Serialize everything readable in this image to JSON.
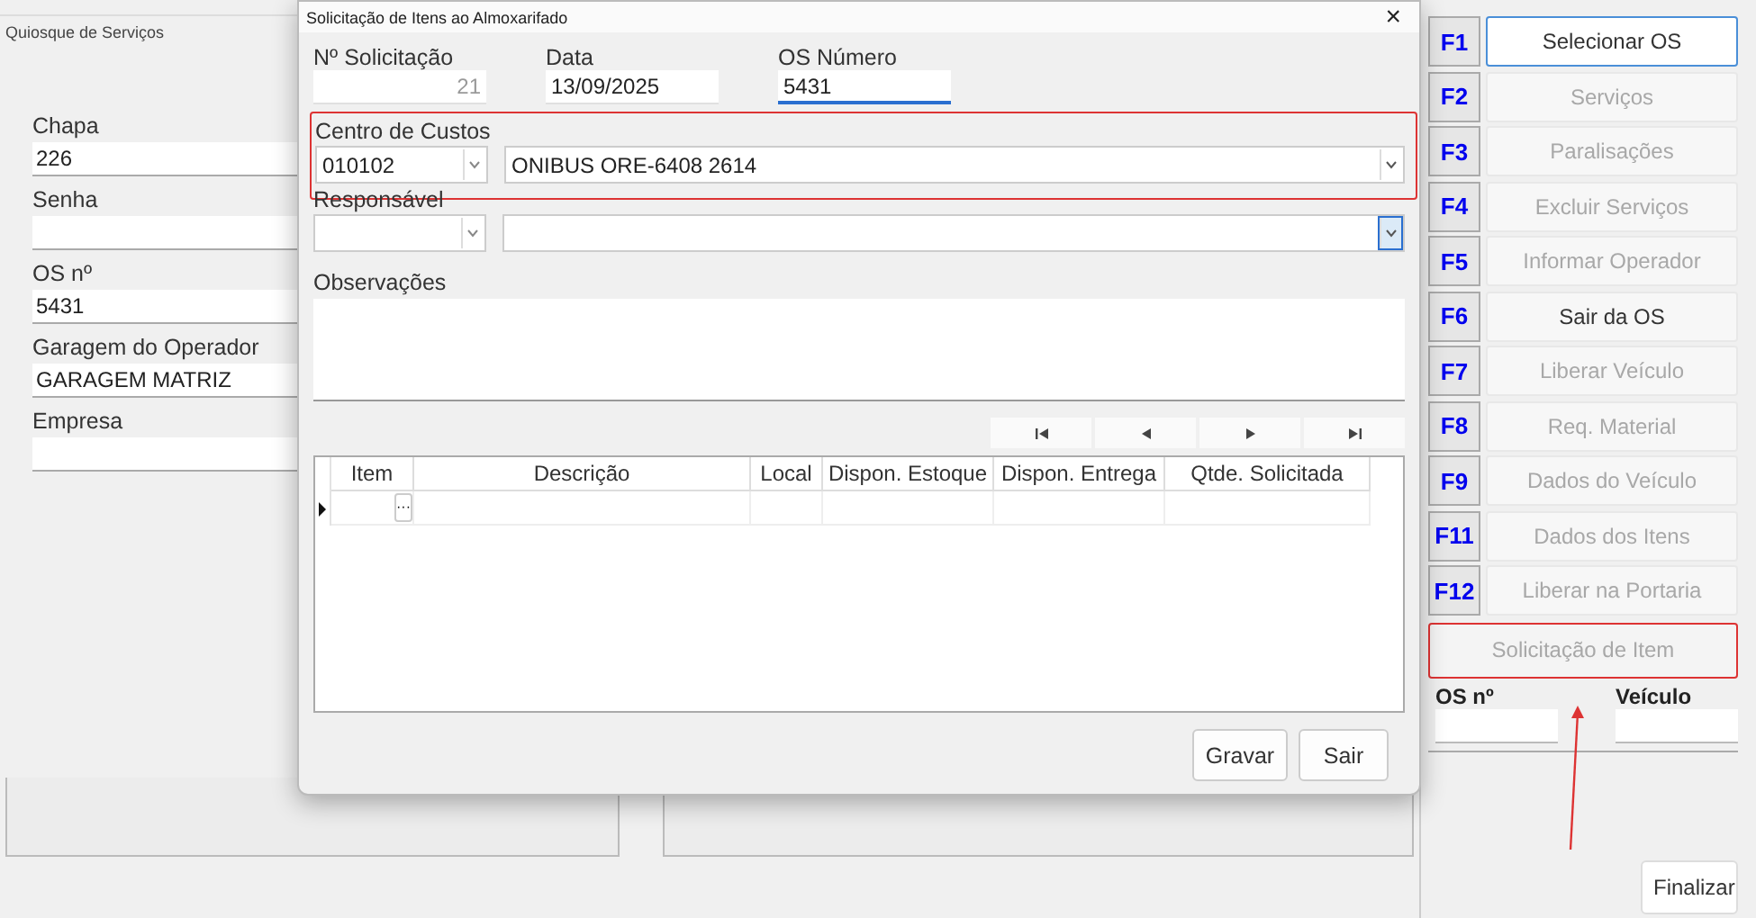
{
  "background_window": {
    "title": "Quiosque de Serviços",
    "fields": [
      {
        "label": "Chapa",
        "value": "226"
      },
      {
        "label": "Senha"
      },
      {
        "label": "OS nº",
        "value": "5431"
      },
      {
        "label": "Garagem do Operador",
        "value": "GARAGEM MATRIZ"
      },
      {
        "label": "Empresa"
      }
    ]
  },
  "dialog": {
    "title": "Solicitação de Itens ao Almoxarifado",
    "close": "×",
    "header_fields": [
      {
        "label": "Nº Solicitação",
        "value": "21",
        "kind": "readonly"
      },
      {
        "label": "Data",
        "value": "13/09/2025",
        "kind": "text"
      },
      {
        "label": "OS Número",
        "value": "5431",
        "kind": "focused"
      }
    ],
    "centro_de_custos": {
      "label": "Centro de Custos",
      "code": "010102",
      "description": "ONIBUS ORE-6408 2614",
      "highlighted": true
    },
    "responsavel": {
      "label": "Responsável"
    },
    "observacoes": {
      "label": "Observações"
    },
    "grid": {
      "columns": [
        "Item",
        "Descrição",
        "Local",
        "Dispon. Estoque",
        "Dispon. Entrega",
        "Qtde. Solicitada"
      ],
      "rows": [
        {
          "current": true,
          "cell_button": "···"
        }
      ]
    },
    "buttons": [
      "Gravar",
      "Sair"
    ]
  },
  "function_keys": [
    {
      "key": "F1",
      "label": "Selecionar OS",
      "disabled": false,
      "focused": true
    },
    {
      "key": "F2",
      "label": "Serviços",
      "disabled": true,
      "focused": false
    },
    {
      "key": "F3",
      "label": "Paralisações",
      "disabled": true,
      "focused": false
    },
    {
      "key": "F4",
      "label": "Excluir Serviços",
      "disabled": true,
      "focused": false
    },
    {
      "key": "F5",
      "label": "Informar Operador",
      "disabled": true,
      "focused": false
    },
    {
      "key": "F6",
      "label": "Sair da OS",
      "disabled": false,
      "focused": false
    },
    {
      "key": "F7",
      "label": "Liberar Veículo",
      "disabled": true,
      "focused": false
    },
    {
      "key": "F8",
      "label": "Req. Material",
      "disabled": true,
      "focused": false
    },
    {
      "key": "F9",
      "label": "Dados do Veículo",
      "disabled": true,
      "focused": false
    },
    {
      "key": "F11",
      "label": "Dados dos Itens",
      "disabled": true,
      "focused": false
    },
    {
      "key": "F12",
      "label": "Liberar na Portaria",
      "disabled": true,
      "focused": false
    }
  ],
  "item_request_button": {
    "label": "Solicitação de Item",
    "disabled": true,
    "highlighted": true
  },
  "summary_fields": [
    {
      "label": "OS nº"
    },
    {
      "label": "Veículo"
    }
  ],
  "finish_button": "Finalizar"
}
